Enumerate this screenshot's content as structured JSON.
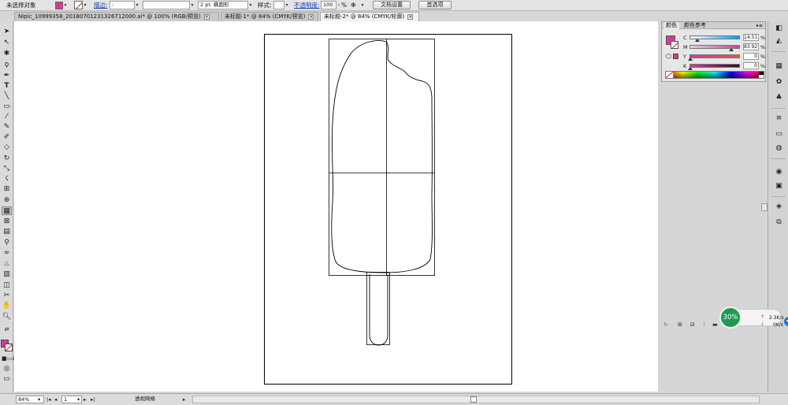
{
  "control_bar": {
    "selection_label": "未选择对象",
    "stroke_label": "描边:",
    "stroke_width": ":",
    "brush_label": "2 pt. 椭圆形",
    "style_label": "样式:",
    "opacity_label": "不透明度:",
    "opacity_value": "100",
    "opacity_unit": "%",
    "doc_setup": "文档设置",
    "preferences": "首选项",
    "fill_color": "#d63b93"
  },
  "tabs": [
    {
      "label": "Nipic_10999358_20180701231326712000.ai* @ 100% (RGB/预览)"
    },
    {
      "label": "未标题-1* @ 84% (CMYK/预览)"
    },
    {
      "label": "未标题-2* @ 84% (CMYK/轮廓)"
    }
  ],
  "active_tab": 2,
  "color_panel": {
    "tabs": [
      "颜色",
      "颜色参考"
    ],
    "channels": [
      {
        "name": "C",
        "value": "14.51",
        "fraction": 0.1451
      },
      {
        "name": "M",
        "value": "83.92",
        "fraction": 0.8392
      },
      {
        "name": "Y",
        "value": "0",
        "fraction": 0
      },
      {
        "name": "K",
        "value": "0",
        "fraction": 0
      }
    ],
    "percent": "%"
  },
  "speed_widget": {
    "percent": "30%",
    "up": "2.3K/s",
    "down": "0K/s"
  },
  "status_bar": {
    "zoom": "84%",
    "page": "1",
    "tool_name": "透视网格"
  }
}
